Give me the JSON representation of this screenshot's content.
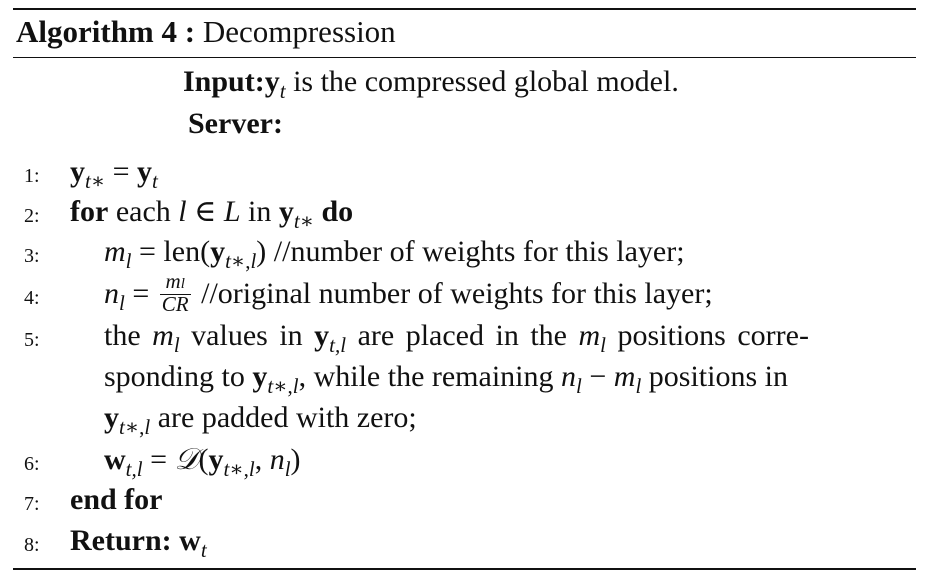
{
  "algorithm": {
    "label": "Algorithm 4 :",
    "name": "Decompression"
  },
  "input": {
    "label": "Input:",
    "description": " is the compressed global model."
  },
  "server_label": "Server:",
  "lines": [
    {
      "number": "1:"
    },
    {
      "number": "2:",
      "for": "for",
      "each": " each ",
      "in": " in ",
      "do": "do"
    },
    {
      "number": "3:",
      "comment": "//number of weights for this layer;"
    },
    {
      "number": "4:",
      "comment": "//original number of weights for this layer;"
    },
    {
      "number": "5:",
      "text_a": "the ",
      "text_b": " values in ",
      "text_c": " are placed in the ",
      "text_d": " positions corre-",
      "text_e": "sponding to ",
      "text_f": ", while the remaining ",
      "text_g": " positions in",
      "text_h": " are padded with zero;"
    },
    {
      "number": "6:"
    },
    {
      "number": "7:",
      "text": "end for"
    },
    {
      "number": "8:",
      "text": "Return:"
    }
  ]
}
